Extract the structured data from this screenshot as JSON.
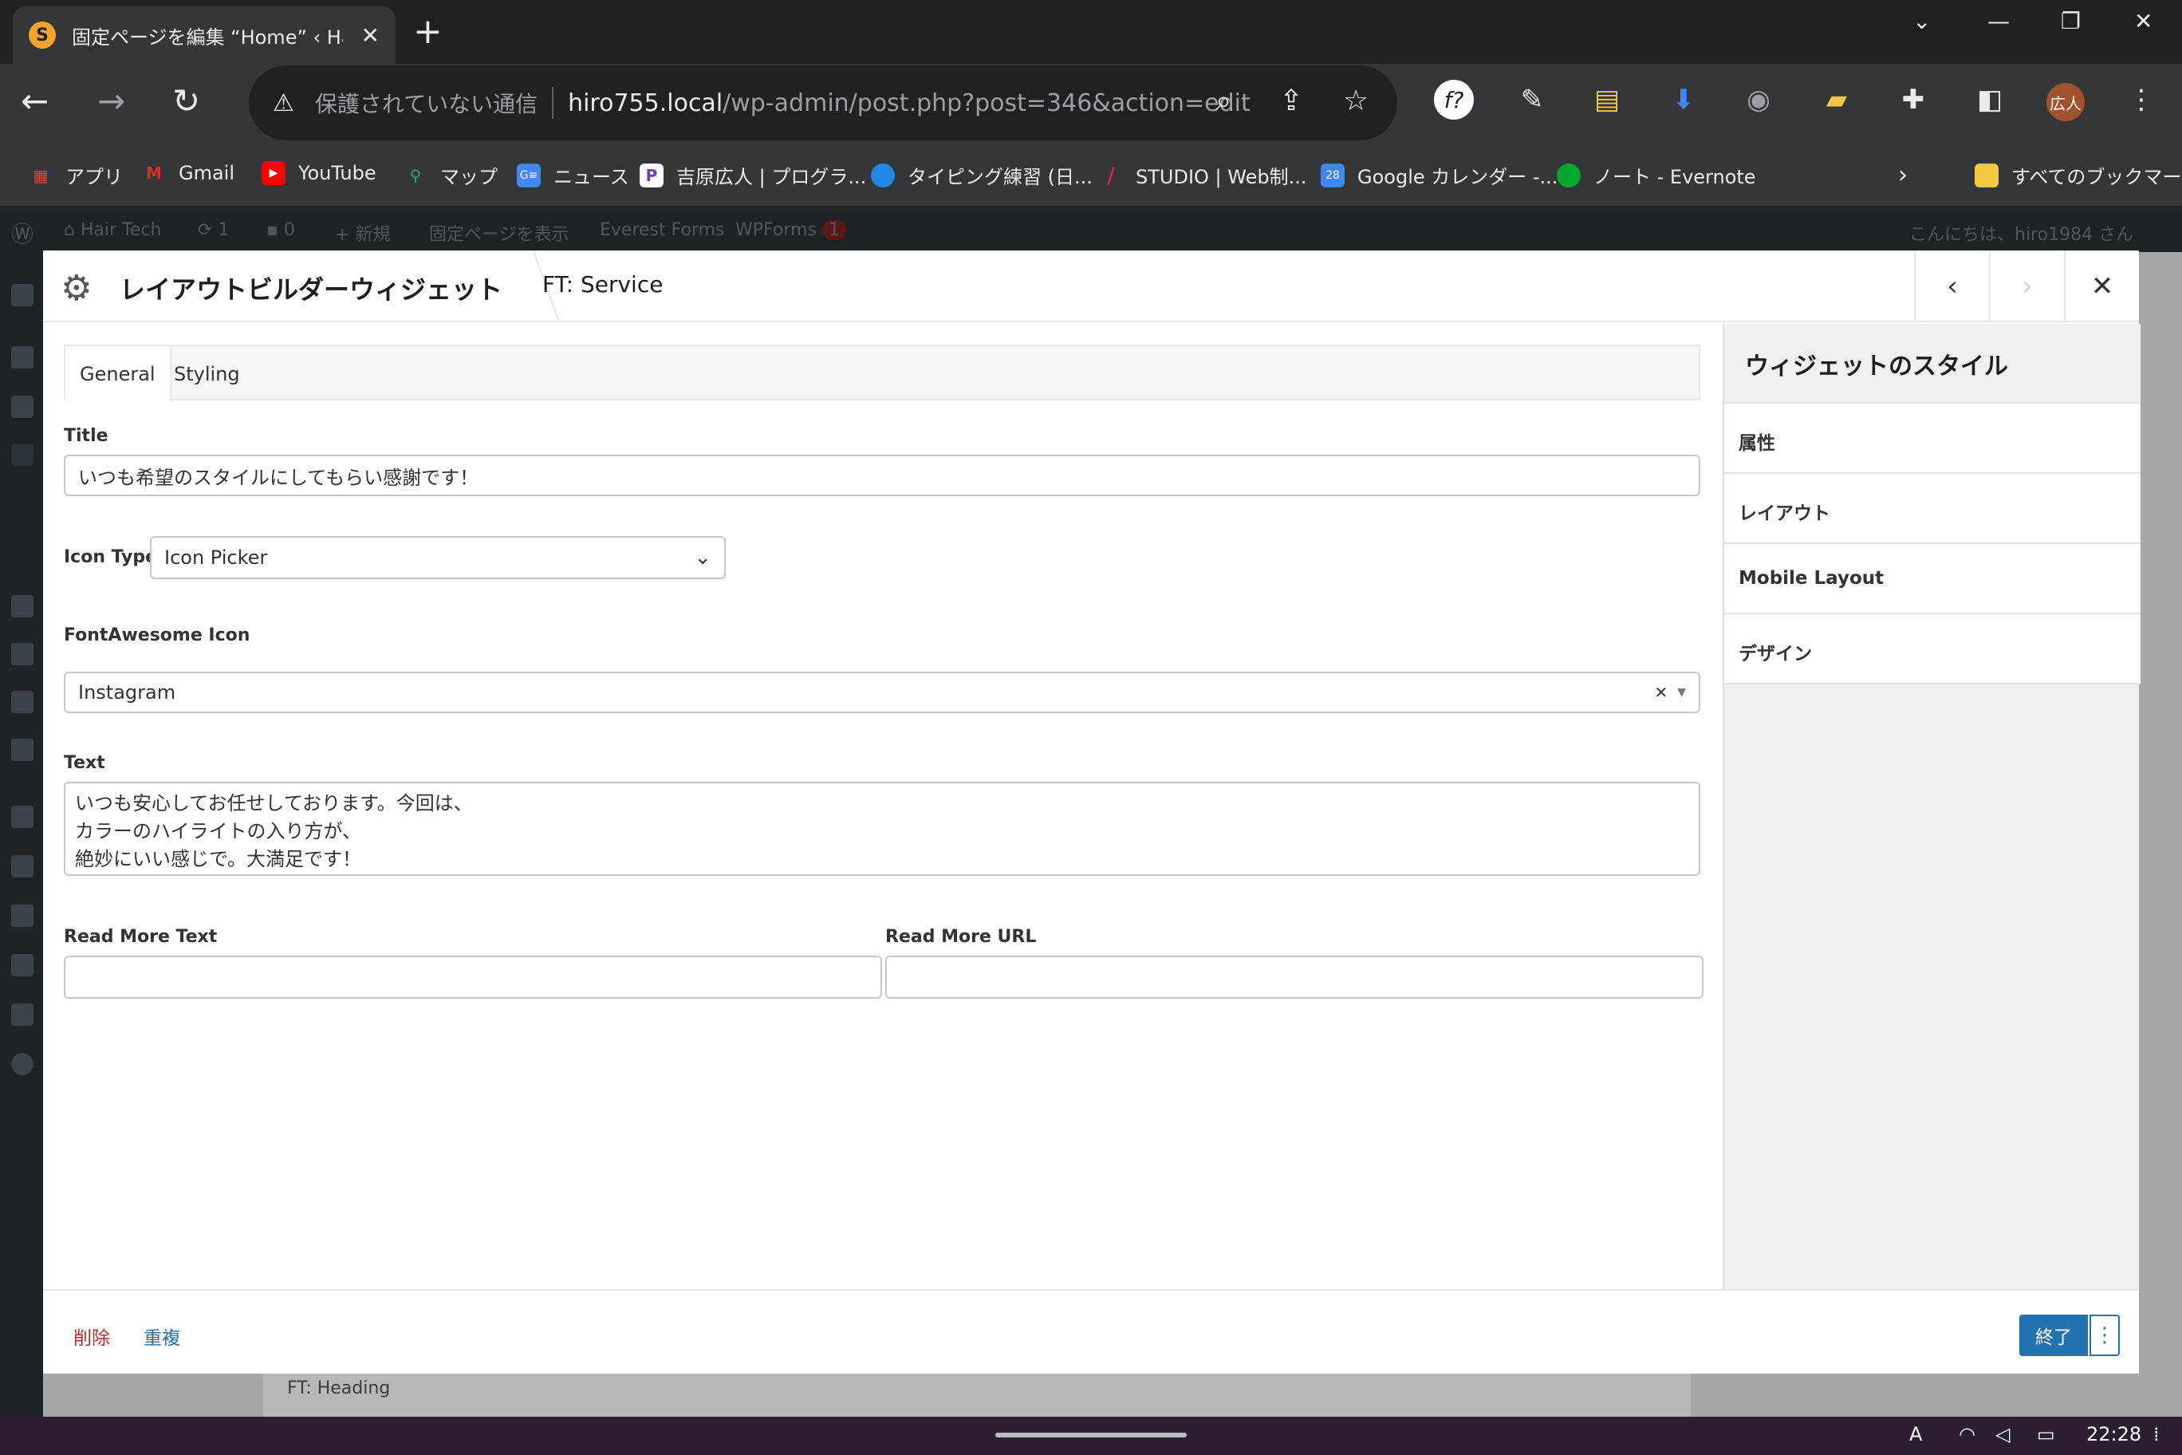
{
  "browser": {
    "tab_title": "固定ページを編集 “Home” ‹ Ha",
    "tab_favicon": "S",
    "omnibox": {
      "insecure_label": "保護されていない通信",
      "url_host": "hiro755.local",
      "url_path": "/wp-admin/post.php?post=346&action=edit"
    },
    "avatar_label": "広人",
    "bookmarks": [
      {
        "label": "アプリ",
        "icon": "apps-grid-icon",
        "color": "#ea4335"
      },
      {
        "label": "Gmail",
        "icon": "gmail-icon",
        "color": "#d93025"
      },
      {
        "label": "YouTube",
        "icon": "youtube-icon",
        "color": "#ff0000"
      },
      {
        "label": "マップ",
        "icon": "maps-icon",
        "color": "#34a853"
      },
      {
        "label": "ニュース",
        "icon": "news-icon",
        "color": "#4285f4"
      },
      {
        "label": "吉原広人 | プログラ...",
        "icon": "p-icon",
        "color": "#6a3fb5"
      },
      {
        "label": "タイピング練習 (日...",
        "icon": "typing-icon",
        "color": "#1e88e5"
      },
      {
        "label": "STUDIO | Web制...",
        "icon": "studio-icon",
        "color": "#e91e63"
      },
      {
        "label": "Google カレンダー -...",
        "icon": "calendar-icon",
        "color": "#4285f4"
      },
      {
        "label": "ノート - Evernote",
        "icon": "evernote-icon",
        "color": "#00a82d"
      },
      {
        "label": "すべてのブックマーク",
        "icon": "folder-icon",
        "color": "#f6c744"
      }
    ]
  },
  "adminbar": {
    "site_name": "Hair Tech",
    "updates": "1",
    "comments": "0",
    "new_label": "新規",
    "view_page": "固定ページを表示",
    "everest": "Everest Forms",
    "wpforms": "WPForms",
    "wpforms_badge": "1",
    "greeting": "こんにちは、hiro1984 さん"
  },
  "modal": {
    "title": "レイアウトビルダーウィジェット",
    "widget_name": "FT: Service",
    "tabs": [
      "General",
      "Styling"
    ],
    "fields": {
      "title_label": "Title",
      "title_value": "いつも希望のスタイルにしてもらい感謝です！",
      "icon_type_label": "Icon Type",
      "icon_type_value": "Icon Picker",
      "fa_label": "FontAwesome Icon",
      "fa_value": "Instagram",
      "text_label": "Text",
      "text_lines": [
        "いつも安心してお任せしております。今回は、",
        "カラーのハイライトの入り方が、",
        "絶妙にいい感じで。大満足です！"
      ],
      "read_more_text_label": "Read More Text",
      "read_more_text_value": "",
      "read_more_url_label": "Read More URL",
      "read_more_url_value": ""
    },
    "sidebar": {
      "heading": "ウィジェットのスタイル",
      "items": [
        "属性",
        "レイアウト",
        "Mobile Layout",
        "デザイン"
      ]
    },
    "footer": {
      "delete": "削除",
      "duplicate": "重複",
      "done": "終了"
    }
  },
  "background": {
    "card_title": "FT: Heading"
  },
  "taskbar": {
    "time": "22:28"
  },
  "colors": {
    "primary": "#2271b1",
    "danger": "#b32d2e"
  }
}
